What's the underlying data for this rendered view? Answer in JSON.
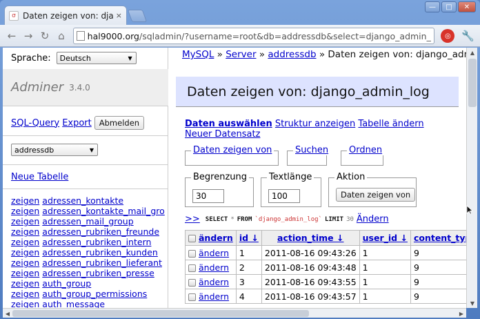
{
  "browser": {
    "tab_title": "Daten zeigen von: django",
    "tab_close": "×",
    "url_host": "hal9000.org",
    "url_path": "/sqladmin/?username=root&db=addressdb&select=django_admin_log"
  },
  "menu": {
    "language_label": "Sprache:",
    "language_value": "Deutsch",
    "brand_name": "Adminer",
    "version": "3.4.0",
    "sql_query": "SQL-Query",
    "export": "Export",
    "logout": "Abmelden",
    "database": "addressdb",
    "new_table": "Neue Tabelle",
    "show_label": "zeigen",
    "tables": [
      "adressen_kontakte",
      "adressen_kontakte_mail_gro",
      "adressen_mail_group",
      "adressen_rubriken_freunde",
      "adressen_rubriken_intern",
      "adressen_rubriken_kunden",
      "adressen_rubriken_lieferant",
      "adressen_rubriken_presse",
      "auth_group",
      "auth_group_permissions",
      "auth_message"
    ]
  },
  "breadcrumb": {
    "mysql": "MySQL",
    "sep": "»",
    "server": "Server",
    "db": "addressdb",
    "current": "Daten zeigen von: django_admin_"
  },
  "page": {
    "title": "Daten zeigen von: django_admin_log",
    "action_select": "Daten auswählen",
    "action_structure": "Struktur anzeigen",
    "action_alter": "Tabelle ändern",
    "action_new": "Neuer Datensatz",
    "fs_columns": "Daten zeigen von",
    "fs_search": "Suchen",
    "fs_order": "Ordnen",
    "limit_label": "Begrenzung",
    "limit_value": "30",
    "textlength_label": "Textlänge",
    "textlength_value": "100",
    "action_label": "Aktion",
    "submit_label": "Daten zeigen von"
  },
  "sql": {
    "toggle": ">>",
    "select": "SELECT",
    "star": "*",
    "from": "FROM",
    "table": "`django_admin_log`",
    "limit": "LIMIT",
    "limit_value": "30",
    "edit": "Ändern"
  },
  "table": {
    "edit_label": "ändern",
    "headers": [
      "id ↓",
      "action_time ↓",
      "user_id ↓",
      "content_type_id ↓"
    ],
    "rows": [
      [
        "1",
        "2011-08-16 09:43:26",
        "1",
        "9"
      ],
      [
        "2",
        "2011-08-16 09:43:48",
        "1",
        "9"
      ],
      [
        "3",
        "2011-08-16 09:43:55",
        "1",
        "9"
      ],
      [
        "4",
        "2011-08-16 09:43:57",
        "1",
        "9"
      ]
    ]
  }
}
